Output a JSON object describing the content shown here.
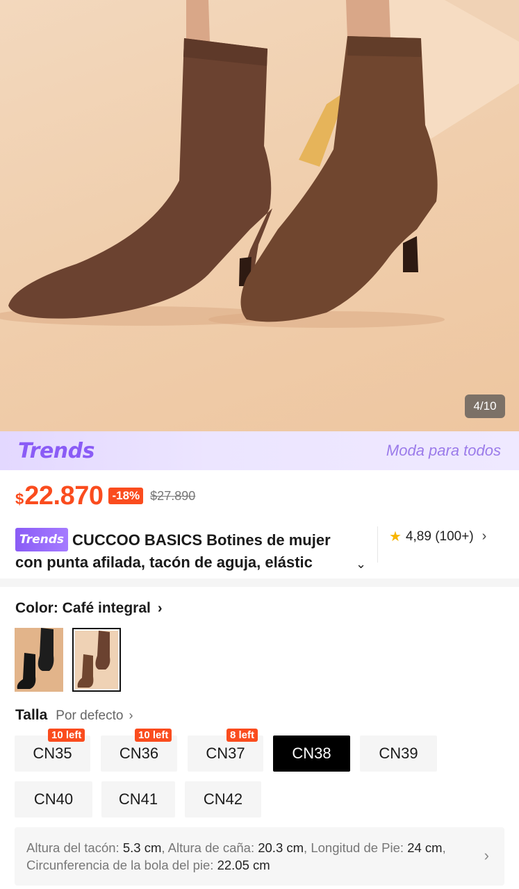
{
  "gallery": {
    "counter": "4/10"
  },
  "banner": {
    "logo": "Trends",
    "tagline": "Moda para todos"
  },
  "price": {
    "currency": "$",
    "amount": "22.870",
    "discount": "-18%",
    "original": "$27.890"
  },
  "product": {
    "badge": "Trends",
    "title_line1": "CUCCOO BASICS Botines de mujer",
    "title_line2": "con punta afilada, tacón de aguja, elástic",
    "rating": "4,89",
    "reviews": "(100+)"
  },
  "color": {
    "label": "Color: Café integral",
    "options": [
      "black",
      "brown"
    ],
    "selected_index": 1
  },
  "size": {
    "label": "Talla",
    "default": "Por defecto",
    "options": [
      {
        "name": "CN35",
        "stock": "10 left"
      },
      {
        "name": "CN36",
        "stock": "10 left"
      },
      {
        "name": "CN37",
        "stock": "8 left"
      },
      {
        "name": "CN38",
        "stock": ""
      },
      {
        "name": "CN39",
        "stock": ""
      },
      {
        "name": "CN40",
        "stock": ""
      },
      {
        "name": "CN41",
        "stock": ""
      },
      {
        "name": "CN42",
        "stock": ""
      }
    ],
    "selected": "CN38"
  },
  "measurements": {
    "heel_label": "Altura del tacón:",
    "heel": "5.3 cm",
    "shaft_label": "Altura de caña:",
    "shaft": "20.3 cm",
    "foot_label_a": "Longitud de",
    "foot_label_b": "Pie:",
    "foot": "24 cm",
    "ball_label": "Circunferencia de la bola del pie:",
    "ball": "22.05 cm"
  },
  "colors": {
    "accent": "#fa4c1e",
    "trends": "#8a5cf6",
    "boot": "#6b4230"
  }
}
